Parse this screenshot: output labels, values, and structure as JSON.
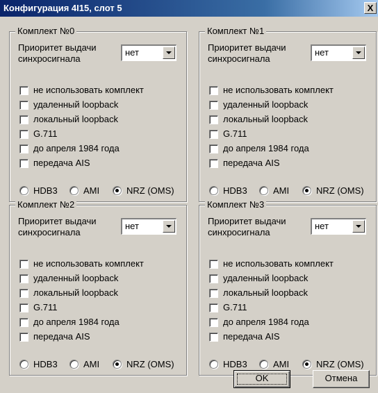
{
  "window": {
    "title": "Конфигурация 4I15, слот 5",
    "close_label": "X"
  },
  "common": {
    "priority_label_line1": "Приоритет выдачи",
    "priority_label_line2": "синхросигнала",
    "checkbox_labels": [
      "не использовать комплект",
      "удаленный loopback",
      "локальный loopback",
      "G.711",
      "до апреля 1984 года",
      "передача AIS"
    ],
    "radio_labels": [
      "HDB3",
      "AMI",
      "NRZ (OMS)"
    ]
  },
  "groups": [
    {
      "title": "Комплект №0",
      "priority_value": "нет",
      "checked": [
        false,
        false,
        false,
        false,
        false,
        false
      ],
      "selected_coding": "NRZ (OMS)"
    },
    {
      "title": "Комплект №1",
      "priority_value": "нет",
      "checked": [
        false,
        false,
        false,
        false,
        false,
        false
      ],
      "selected_coding": "NRZ (OMS)"
    },
    {
      "title": "Комплект №2",
      "priority_value": "нет",
      "checked": [
        false,
        false,
        false,
        false,
        false,
        false
      ],
      "selected_coding": "NRZ (OMS)"
    },
    {
      "title": "Комплект №3",
      "priority_value": "нет",
      "checked": [
        false,
        false,
        false,
        false,
        false,
        false
      ],
      "selected_coding": "NRZ (OMS)"
    }
  ],
  "buttons": {
    "ok": "OK",
    "cancel": "Отмена"
  }
}
